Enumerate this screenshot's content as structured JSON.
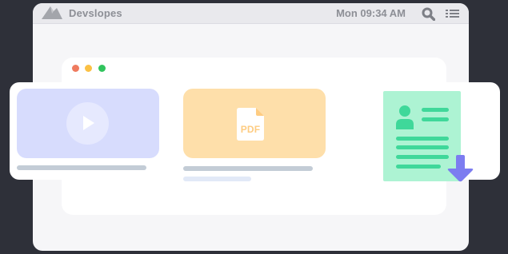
{
  "menubar": {
    "app_name": "Devslopes",
    "clock": "Mon 09:34 AM",
    "logo_icon": "mountain-logo-icon",
    "search_icon": "search-icon",
    "menu_icon": "list-menu-icon"
  },
  "window_controls": {
    "colors": [
      "#ef7b5f",
      "#fbc145",
      "#31c45d"
    ],
    "icons": [
      "close-dot-icon",
      "minimize-dot-icon",
      "maximize-dot-icon"
    ]
  },
  "cards": {
    "video": {
      "icon": "play-icon",
      "accent": "#d7dcfd"
    },
    "pdf": {
      "label": "PDF",
      "icon": "pdf-file-icon",
      "accent": "#fedfaa"
    },
    "resume": {
      "icon": "resume-document-icon",
      "download_icon": "download-arrow-icon",
      "accent": "#adf3d3",
      "arrow_color": "#7c7cf0"
    }
  },
  "colors": {
    "background": "#2e3039",
    "menubar_text": "#8d8f96",
    "placeholder_bar": "#c3ccd6",
    "placeholder_bar_light": "#e2e9f7"
  }
}
